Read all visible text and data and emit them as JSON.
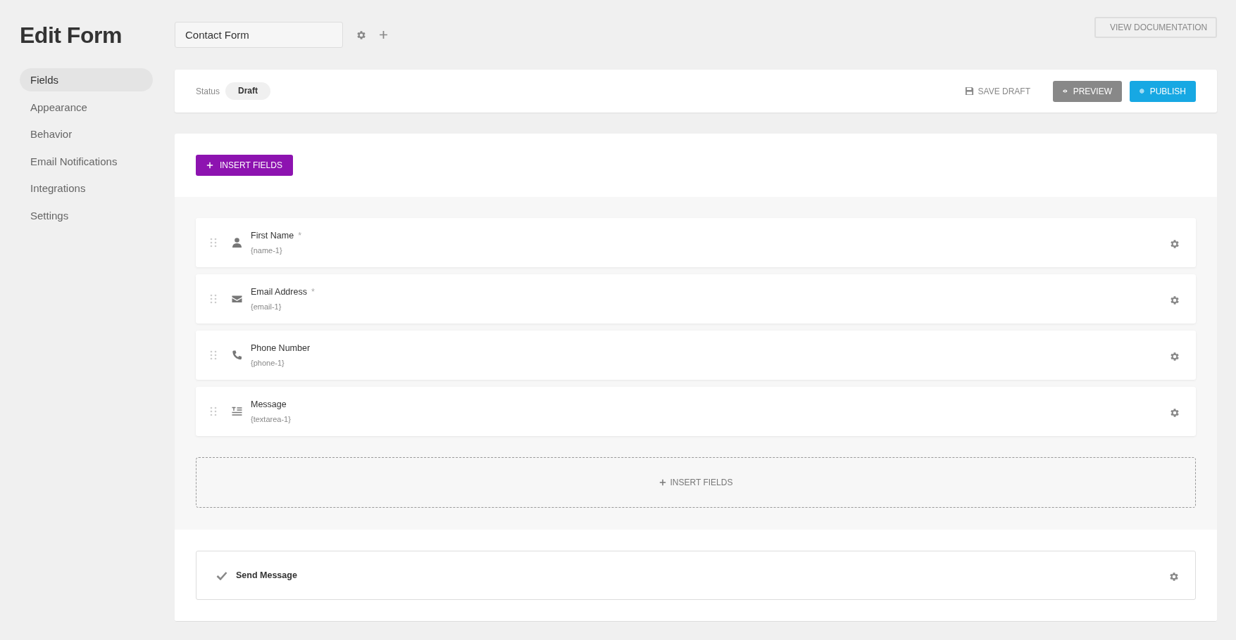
{
  "page_title": "Edit Form",
  "sidebar": {
    "items": [
      {
        "label": "Fields",
        "selected": true
      },
      {
        "label": "Appearance",
        "selected": false
      },
      {
        "label": "Behavior",
        "selected": false
      },
      {
        "label": "Email Notifications",
        "selected": false
      },
      {
        "label": "Integrations",
        "selected": false
      },
      {
        "label": "Settings",
        "selected": false
      }
    ]
  },
  "form_name": {
    "value": "Contact Form"
  },
  "view_documentation": "VIEW DOCUMENTATION",
  "status_bar": {
    "label": "Status",
    "status": "Draft",
    "save_draft": "SAVE DRAFT",
    "preview": "PREVIEW",
    "publish": "PUBLISH"
  },
  "insert_fields_button": "INSERT FIELDS",
  "fields": [
    {
      "kind": "name",
      "label": "First Name",
      "required_mark": "*",
      "tag": "{name-1}"
    },
    {
      "kind": "email",
      "label": "Email Address",
      "required_mark": "*",
      "tag": "{email-1}"
    },
    {
      "kind": "phone",
      "label": "Phone Number",
      "tag": "{phone-1}"
    },
    {
      "kind": "textarea",
      "label": "Message",
      "tag": "{textarea-1}"
    }
  ],
  "insert_fields_dropzone": "INSERT FIELDS",
  "submit": {
    "label": "Send Message"
  }
}
